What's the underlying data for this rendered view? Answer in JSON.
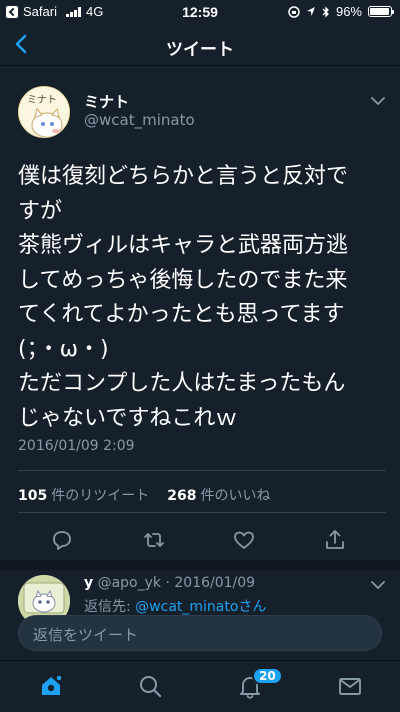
{
  "status_bar": {
    "back_app": "Safari",
    "carrier": "4G",
    "time": "12:59",
    "battery": "96%",
    "battery_level": 0.96
  },
  "nav": {
    "title": "ツイート"
  },
  "tweet": {
    "avatar_text": "ミナト",
    "author_name": "ミナト",
    "author_handle": "@wcat_minato",
    "text": "僕は復刻どちらかと言うと反対で\nすが\n茶熊ヴィルはキャラと武器両方逃\nしてめっちゃ後悔したのでまた来\nてくれてよかったとも思ってます\n(；・ω・)\nただコンプした人はたまったもん\nじゃないですねこれｗ",
    "date": "2016/01/09 2:09",
    "retweet_count": "105",
    "retweet_label": "件のリツイート",
    "like_count": "268",
    "like_label": "件のいいね"
  },
  "reply": {
    "author_name": "y",
    "author_handle": "@apo_yk",
    "date": "· 2016/01/09",
    "preview_prefix": "返信先: ",
    "preview_mention": "@wcat_minatoさん"
  },
  "reply_input": {
    "placeholder": "返信をツイート"
  },
  "tab_bar": {
    "notifications_badge": "20"
  },
  "colors": {
    "background": "#15202b",
    "accent": "#1da1f2",
    "secondary_text": "#8899a6"
  }
}
